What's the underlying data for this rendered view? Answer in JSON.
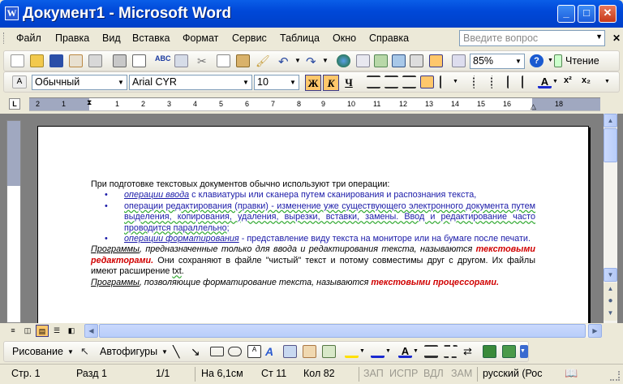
{
  "window": {
    "title": "Документ1 - Microsoft Word",
    "app_icon_letter": "W",
    "buttons": {
      "minimize": "_",
      "maximize": "□",
      "close": "✕"
    }
  },
  "menubar": {
    "items": [
      "Файл",
      "Правка",
      "Вид",
      "Вставка",
      "Формат",
      "Сервис",
      "Таблица",
      "Окно",
      "Справка"
    ],
    "help_placeholder": "Введите вопрос"
  },
  "standard_toolbar": {
    "zoom": "85%",
    "reading_label": "Чтение"
  },
  "format_toolbar": {
    "style": "Обычный",
    "font": "Arial CYR",
    "size": "10",
    "bold": "Ж",
    "italic": "К",
    "underline": "Ч"
  },
  "ruler": {
    "corner": "L",
    "numbers": [
      "2",
      "1",
      "1",
      "2",
      "3",
      "4",
      "5",
      "6",
      "7",
      "8",
      "9",
      "10",
      "11",
      "12",
      "13",
      "14",
      "15",
      "16",
      "18"
    ]
  },
  "document": {
    "intro": "При подготовке текстовых документов обычно используют три операции:",
    "bullets": [
      {
        "term": "операции ввода",
        "rest": " с клавиатуры или сканера путем сканирования и распознания текста,"
      },
      {
        "term": "",
        "rest": "операции редактирования (правки) - изменение уже существующего электронного документа путем выделения, копирования, удаления, вырезки, вставки, замены. Ввод и редактирование часто проводится параллельно;"
      },
      {
        "term": "операции форматирования",
        "rest": " - представление виду текста на мониторе или на бумаге после печати."
      }
    ],
    "para1_term": "Программы",
    "para1_mid": ", предназначенные только для ввода и редактирования текста, называются ",
    "para1_red": "текстовыми редакторами.",
    "para1_tail": " Они сохраняют в файле \"чистый\" текст и потому совместимы друг с другом. Их файлы имеют расширение ",
    "para1_ext": "txt",
    "para1_end": ".",
    "para2_term": "Программы",
    "para2_mid": ", позволяющие форматирование текста, называются ",
    "para2_red": "текстовыми процессорами."
  },
  "drawing_toolbar": {
    "draw_label": "Рисование",
    "autoshapes_label": "Автофигуры"
  },
  "statusbar": {
    "page": "Стр. 1",
    "section": "Разд 1",
    "pages": "1/1",
    "at": "На 6,1см",
    "line": "Ст 11",
    "col": "Кол 82",
    "rec": "ЗАП",
    "trk": "ИСПР",
    "ext": "ВДЛ",
    "ovr": "ЗАМ",
    "lang": "русский (Рос"
  }
}
